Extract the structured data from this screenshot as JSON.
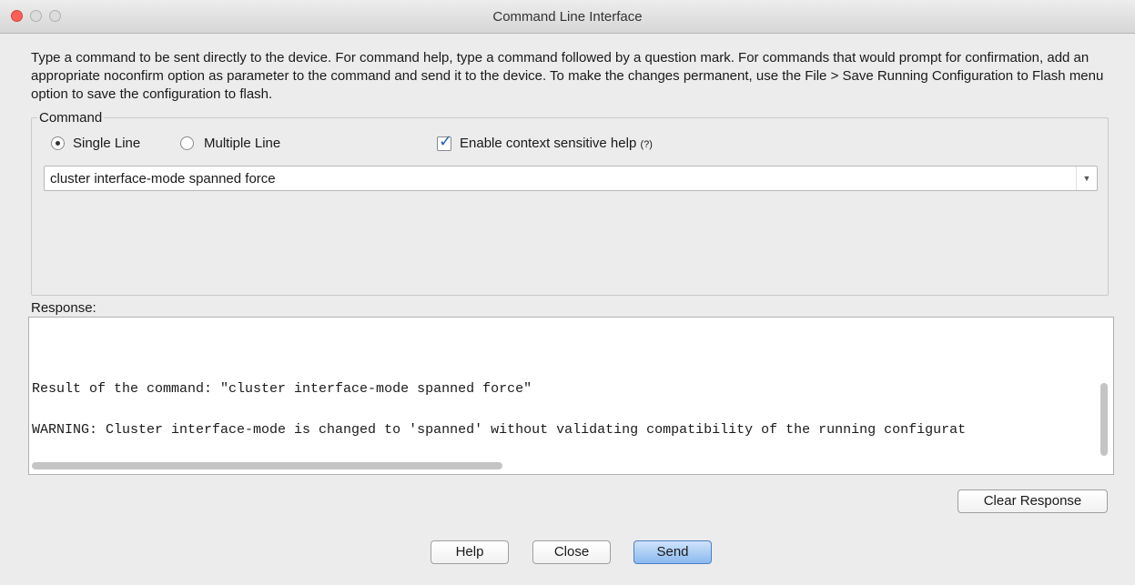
{
  "window": {
    "title": "Command Line Interface"
  },
  "instructions": "Type a command to be sent directly to the device. For command help, type a command followed by a question mark. For commands that would prompt for confirmation, add an appropriate noconfirm option as parameter to the command and send it to the device. To make the changes permanent, use the File > Save Running Configuration to Flash menu option to save the configuration to flash.",
  "command_group": {
    "legend": "Command",
    "radio_single": "Single Line",
    "radio_multiple": "Multiple Line",
    "selected_mode": "Single Line",
    "context_help_label": "Enable context sensitive help",
    "context_help_hint": "(?)",
    "context_help_checked": true,
    "command_value": "cluster interface-mode spanned force"
  },
  "response": {
    "label": "Response:",
    "lines": [
      "Result of the command: \"cluster interface-mode spanned force\"",
      "WARNING: Cluster interface-mode is changed to 'spanned' without validating compatibility of the running configurat"
    ]
  },
  "buttons": {
    "clear_response": "Clear Response",
    "help": "Help",
    "close": "Close",
    "send": "Send"
  },
  "colors": {
    "window_bg": "#ececec",
    "default_button": "#8ab9ef",
    "checkmark": "#2a62b8",
    "close_light": "#ff5f57"
  }
}
